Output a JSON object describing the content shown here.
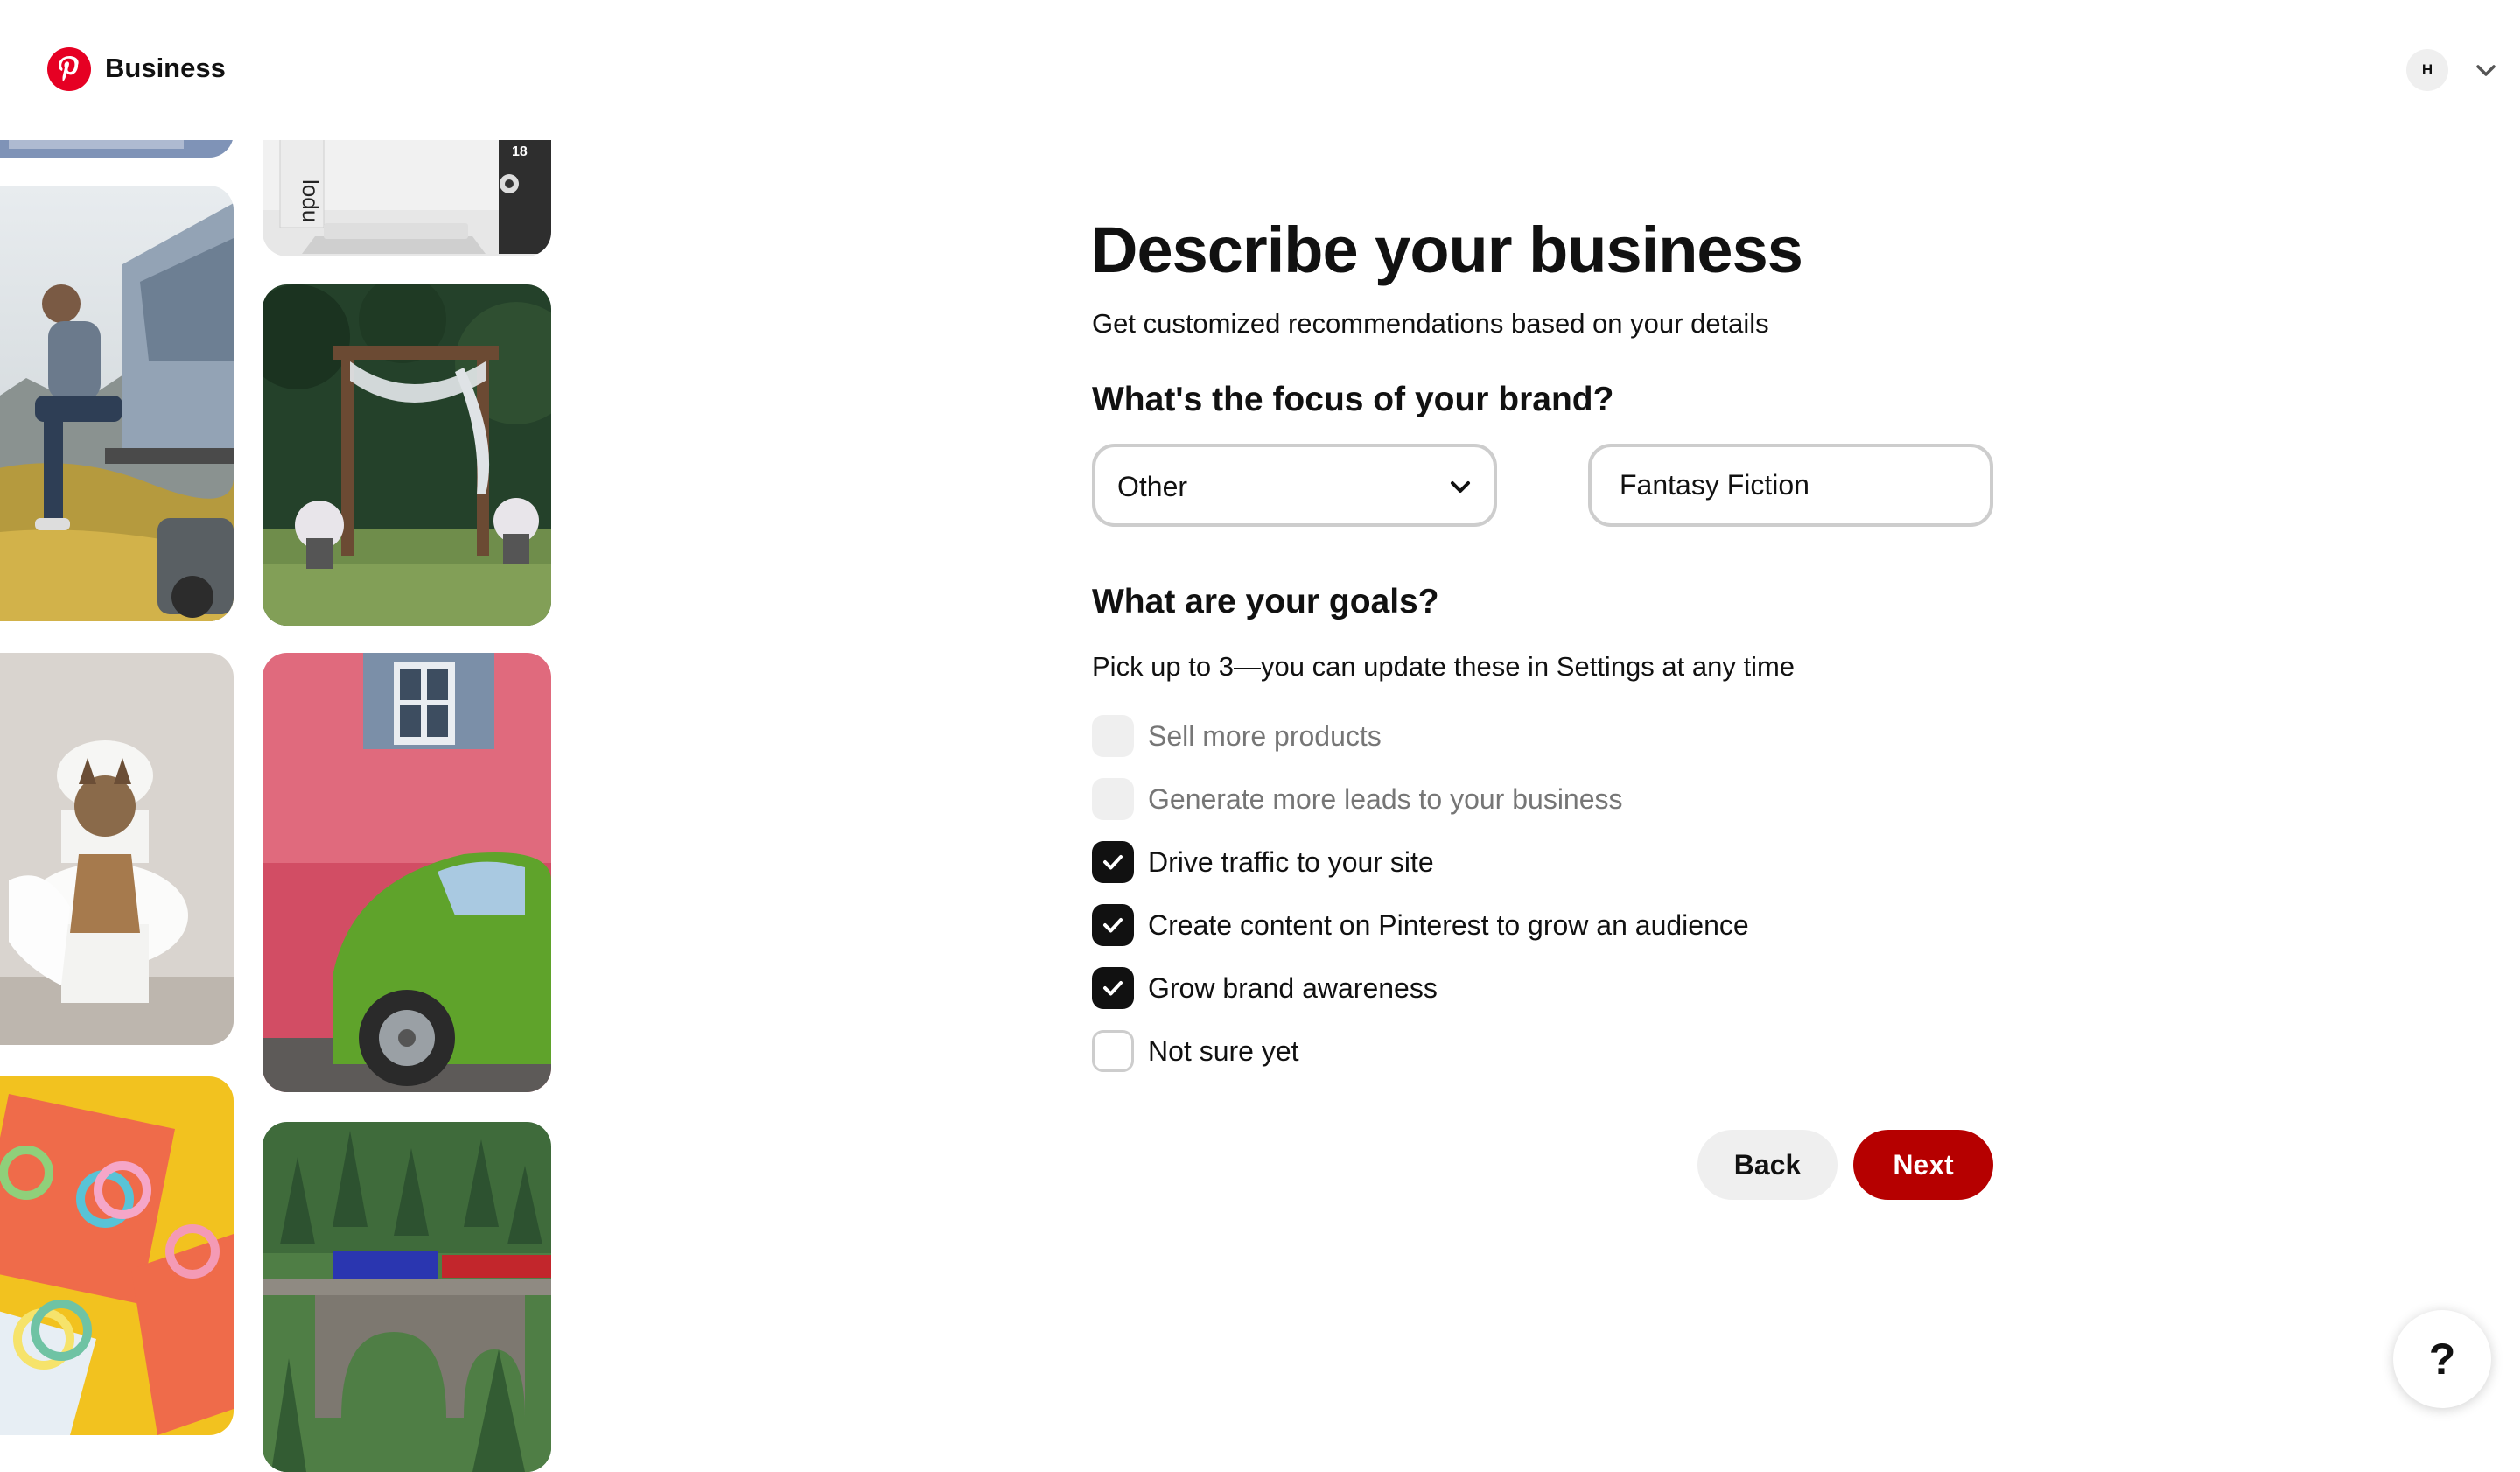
{
  "header": {
    "brand_name": "Business",
    "avatar_initial": "H",
    "brand_color": "#e60023"
  },
  "page": {
    "title": "Describe your business",
    "subtitle": "Get customized recommendations based on your details"
  },
  "focus": {
    "heading": "What's the focus of your brand?",
    "category_value": "Other",
    "detail_value": "Fantasy Fiction"
  },
  "goals": {
    "heading": "What are your goals?",
    "hint": "Pick up to 3—you can update these in Settings at any time",
    "items": [
      {
        "label": "Sell more products",
        "state": "disabled"
      },
      {
        "label": "Generate more leads to your business",
        "state": "disabled"
      },
      {
        "label": "Drive traffic to your site",
        "state": "checked"
      },
      {
        "label": "Create content on Pinterest to grow an audience",
        "state": "checked"
      },
      {
        "label": "Grow brand awareness",
        "state": "checked"
      },
      {
        "label": "Not sure yet",
        "state": "unchecked"
      }
    ]
  },
  "buttons": {
    "back_label": "Back",
    "next_label": "Next",
    "next_color": "#b60000"
  },
  "help": {
    "label": "?"
  },
  "gallery": {
    "images": [
      "camper-on-hill-photo",
      "laptop-desk-photo",
      "wedding-arch-photo",
      "dog-on-toilet-photo",
      "green-beetle-car-photo",
      "slinky-toys-photo",
      "train-bridge-forest-photo"
    ],
    "laptop_badge": "18"
  }
}
